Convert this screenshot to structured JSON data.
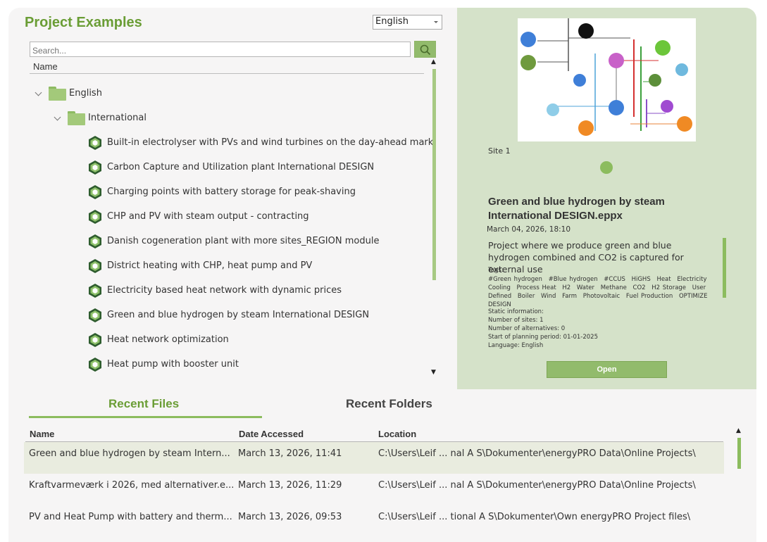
{
  "header": {
    "title": "Project Examples"
  },
  "language_select": {
    "value": "English"
  },
  "search": {
    "placeholder": "Search..."
  },
  "tree": {
    "column_header": "Name",
    "root_folder": "English",
    "sub_folder": "International",
    "items": [
      "Built-in electrolyser with PVs and wind turbines on the day-ahead mark",
      "Carbon Capture and Utilization plant International DESIGN",
      "Charging points with battery storage for peak-shaving",
      "CHP and PV with steam output - contracting",
      "Danish cogeneration plant with more sites_REGION module",
      "District heating with CHP, heat pump and PV",
      "Electricity based heat network with dynamic prices",
      "Green and blue hydrogen by steam International DESIGN",
      "Heat network optimization",
      "Heat pump with booster unit"
    ]
  },
  "preview": {
    "site_label": "Site 1",
    "title": "Green and blue hydrogen by steam International DESIGN.eppx",
    "date": "March 04, 2026, 18:10",
    "description": "Project where we produce green and blue hydrogen combined and CO2 is captured for external use",
    "tags_label": "Tags:",
    "tags": [
      "#Green hydrogen",
      "#Blue hydrogen",
      "#CCUS",
      "HiGHS",
      "Heat",
      "Electricity",
      "Cooling",
      "Process Heat",
      "H2",
      "Water",
      "Methane",
      "CO2",
      "H2 Storage",
      "User Defined",
      "Boiler",
      "Wind",
      "Farm",
      "Photovoltaic",
      "Fuel Production",
      "OPTIMIZE",
      "DESIGN"
    ],
    "static_info": [
      "Static information:",
      "Number of sites: 1",
      "Number of alternatives: 0",
      "Start of planning period: 01-01-2025",
      "Language: English"
    ],
    "open_label": "Open"
  },
  "tabs": {
    "recent_files": "Recent Files",
    "recent_folders": "Recent Folders"
  },
  "recent": {
    "columns": {
      "name": "Name",
      "date": "Date Accessed",
      "location": "Location"
    },
    "rows": [
      {
        "name": "Green and blue hydrogen by steam Intern...",
        "date": "March 13, 2026, 11:41",
        "location": "C:\\Users\\Leif ... nal A S\\Dokumenter\\energyPRO Data\\Online Projects\\"
      },
      {
        "name": "Kraftvarmeværk i 2026, med alternativer.e...",
        "date": "March 13, 2026, 11:29",
        "location": "C:\\Users\\Leif ... nal A S\\Dokumenter\\energyPRO Data\\Online Projects\\"
      },
      {
        "name": "PV and Heat Pump with battery and therm...",
        "date": "March 13, 2026, 09:53",
        "location": "C:\\Users\\Leif ... tional A S\\Dokumenter\\Own energyPRO Project files\\"
      }
    ]
  }
}
